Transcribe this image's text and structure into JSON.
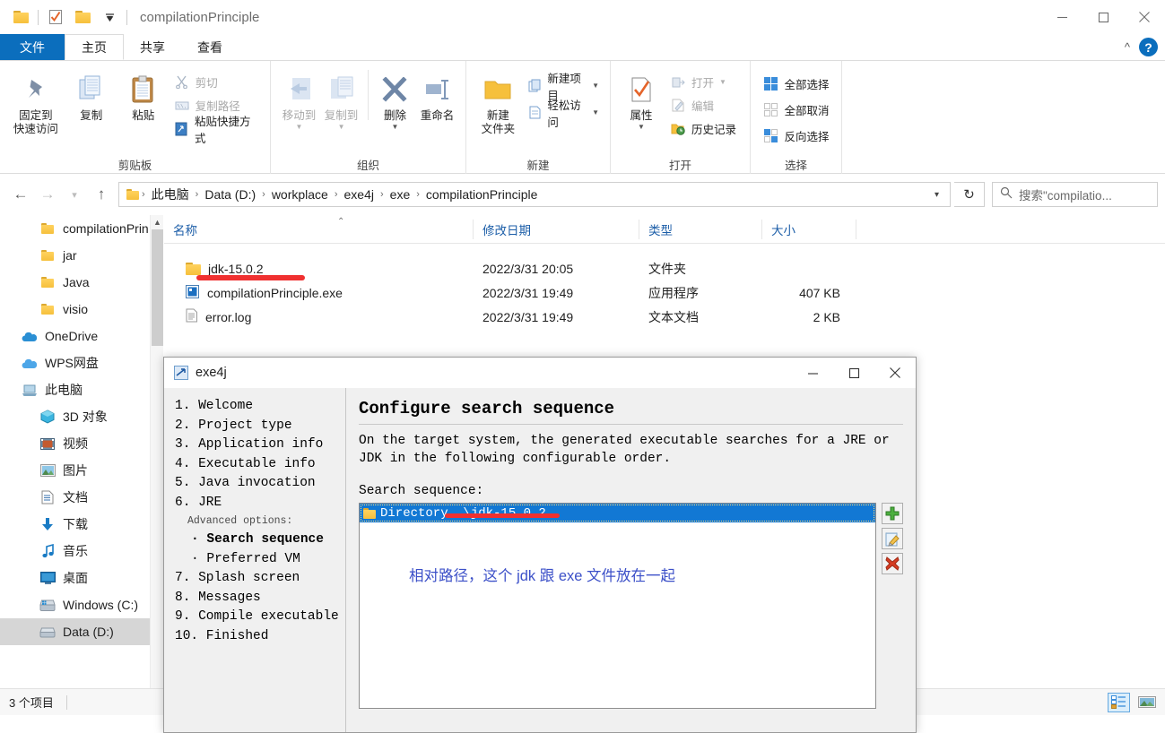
{
  "window": {
    "title": "compilationPrinciple",
    "minimize": "—",
    "maximize": "☐",
    "close": "✕"
  },
  "ribbon": {
    "tabs": [
      {
        "label": "文件",
        "name": "tab-file"
      },
      {
        "label": "主页",
        "name": "tab-home"
      },
      {
        "label": "共享",
        "name": "tab-share"
      },
      {
        "label": "查看",
        "name": "tab-view"
      }
    ],
    "collapse": "⌃",
    "help": "?",
    "groups": [
      {
        "label": "剪贴板",
        "big": [
          {
            "label": "固定到\n快速访问",
            "name": "pin-to-quick-access-button"
          },
          {
            "label": "复制",
            "name": "copy-button"
          },
          {
            "label": "粘贴",
            "name": "paste-button"
          }
        ],
        "small": [
          {
            "label": "剪切",
            "name": "cut-button",
            "dim": true
          },
          {
            "label": "复制路径",
            "name": "copy-path-button",
            "dim": true
          },
          {
            "label": "粘贴快捷方式",
            "name": "paste-shortcut-button",
            "dim": false
          }
        ]
      },
      {
        "label": "组织",
        "big": [
          {
            "label": "移动到",
            "name": "move-to-button",
            "dim": true
          },
          {
            "label": "复制到",
            "name": "copy-to-button",
            "dim": true
          },
          {
            "label": "删除",
            "name": "delete-button"
          },
          {
            "label": "重命名",
            "name": "rename-button"
          }
        ]
      },
      {
        "label": "新建",
        "big": [
          {
            "label": "新建\n文件夹",
            "name": "new-folder-button"
          }
        ],
        "small": [
          {
            "label": "新建项目",
            "name": "new-item-button"
          },
          {
            "label": "轻松访问",
            "name": "easy-access-button"
          }
        ]
      },
      {
        "label": "打开",
        "big": [
          {
            "label": "属性",
            "name": "properties-button"
          }
        ],
        "small": [
          {
            "label": "打开",
            "name": "open-button",
            "dim": true
          },
          {
            "label": "编辑",
            "name": "edit-button",
            "dim": true
          },
          {
            "label": "历史记录",
            "name": "history-button"
          }
        ]
      },
      {
        "label": "选择",
        "small": [
          {
            "label": "全部选择",
            "name": "select-all-button"
          },
          {
            "label": "全部取消",
            "name": "select-none-button"
          },
          {
            "label": "反向选择",
            "name": "invert-selection-button"
          }
        ]
      }
    ]
  },
  "address": {
    "back": "←",
    "forward": "→",
    "recent": "⌄",
    "up": "↑",
    "crumbs": [
      "此电脑",
      "Data (D:)",
      "workplace",
      "exe4j",
      "exe",
      "compilationPrinciple"
    ],
    "separator": "›",
    "dropdown": "⌄",
    "refresh": "↻",
    "search_placeholder": "搜索\"compilatio..."
  },
  "sidebar": {
    "items": [
      {
        "label": "compilationPrin",
        "icon": "folder-icon",
        "indent": 2,
        "selected": false
      },
      {
        "label": "jar",
        "icon": "folder-icon",
        "indent": 2,
        "selected": false
      },
      {
        "label": "Java",
        "icon": "folder-icon",
        "indent": 2,
        "selected": false
      },
      {
        "label": "visio",
        "icon": "folder-icon",
        "indent": 2,
        "selected": false
      },
      {
        "label": "OneDrive",
        "icon": "onedrive-icon",
        "indent": 1,
        "selected": false
      },
      {
        "label": "WPS网盘",
        "icon": "wps-cloud-icon",
        "indent": 1,
        "selected": false
      },
      {
        "label": "此电脑",
        "icon": "this-pc-icon",
        "indent": 1,
        "selected": false
      },
      {
        "label": "3D 对象",
        "icon": "3d-objects-icon",
        "indent": 2,
        "selected": false
      },
      {
        "label": "视频",
        "icon": "videos-icon",
        "indent": 2,
        "selected": false
      },
      {
        "label": "图片",
        "icon": "pictures-icon",
        "indent": 2,
        "selected": false
      },
      {
        "label": "文档",
        "icon": "documents-icon",
        "indent": 2,
        "selected": false
      },
      {
        "label": "下载",
        "icon": "downloads-icon",
        "indent": 2,
        "selected": false
      },
      {
        "label": "音乐",
        "icon": "music-icon",
        "indent": 2,
        "selected": false
      },
      {
        "label": "桌面",
        "icon": "desktop-icon",
        "indent": 2,
        "selected": false
      },
      {
        "label": "Windows (C:)",
        "icon": "drive-c-icon",
        "indent": 2,
        "selected": false
      },
      {
        "label": "Data (D:)",
        "icon": "drive-d-icon",
        "indent": 2,
        "selected": true
      }
    ]
  },
  "filelist": {
    "columns": [
      {
        "label": "名称",
        "name": "column-name"
      },
      {
        "label": "修改日期",
        "name": "column-date"
      },
      {
        "label": "类型",
        "name": "column-type"
      },
      {
        "label": "大小",
        "name": "column-size"
      }
    ],
    "sort_indicator": "⌃",
    "rows": [
      {
        "name": "jdk-15.0.2",
        "date": "2022/3/31 20:05",
        "type": "文件夹",
        "size": "",
        "icon": "folder-icon"
      },
      {
        "name": "compilationPrinciple.exe",
        "date": "2022/3/31 19:49",
        "type": "应用程序",
        "size": "407 KB",
        "icon": "exe-icon"
      },
      {
        "name": "error.log",
        "date": "2022/3/31 19:49",
        "type": "文本文档",
        "size": "2 KB",
        "icon": "text-file-icon"
      }
    ]
  },
  "statusbar": {
    "item_count": "3 个项目",
    "view_details": "details-view",
    "view_large": "large-icons-view"
  },
  "dialog": {
    "title": "exe4j",
    "minimize": "—",
    "maximize": "☐",
    "close": "✕",
    "steps": [
      {
        "text": "1. Welcome",
        "kind": "num"
      },
      {
        "text": "2. Project type",
        "kind": "num"
      },
      {
        "text": "3. Application info",
        "kind": "num"
      },
      {
        "text": "4. Executable info",
        "kind": "num"
      },
      {
        "text": "5. Java invocation",
        "kind": "num"
      },
      {
        "text": "6. JRE",
        "kind": "num"
      },
      {
        "text": "Advanced options:",
        "kind": "adv"
      },
      {
        "text": "· Search sequence",
        "kind": "sub-bold"
      },
      {
        "text": "· Preferred VM",
        "kind": "sub"
      },
      {
        "text": "7. Splash screen",
        "kind": "num"
      },
      {
        "text": "8. Messages",
        "kind": "num"
      },
      {
        "text": "9. Compile executable",
        "kind": "num"
      },
      {
        "text": "10. Finished",
        "kind": "num"
      }
    ],
    "heading": "Configure search sequence",
    "description": "On the target system, the generated executable searches for a JRE or JDK in the following configurable order.",
    "list_label": "Search sequence:",
    "list_items": [
      {
        "label": "Directory .\\jdk-15.0.2",
        "icon": "folder-icon",
        "selected": true
      }
    ],
    "buttons": [
      {
        "name": "add-entry-button",
        "glyph": "+"
      },
      {
        "name": "edit-entry-button",
        "glyph": "edit"
      },
      {
        "name": "remove-entry-button",
        "glyph": "✖"
      }
    ],
    "annotation": "相对路径，这个 jdk 跟 exe 文件放在一起"
  },
  "colors": {
    "accent": "#0b6ebd",
    "selection": "#1278d4",
    "marker_red": "#f03030",
    "annotation_blue": "#3c50c8",
    "column_header": "#1c5ea8"
  }
}
